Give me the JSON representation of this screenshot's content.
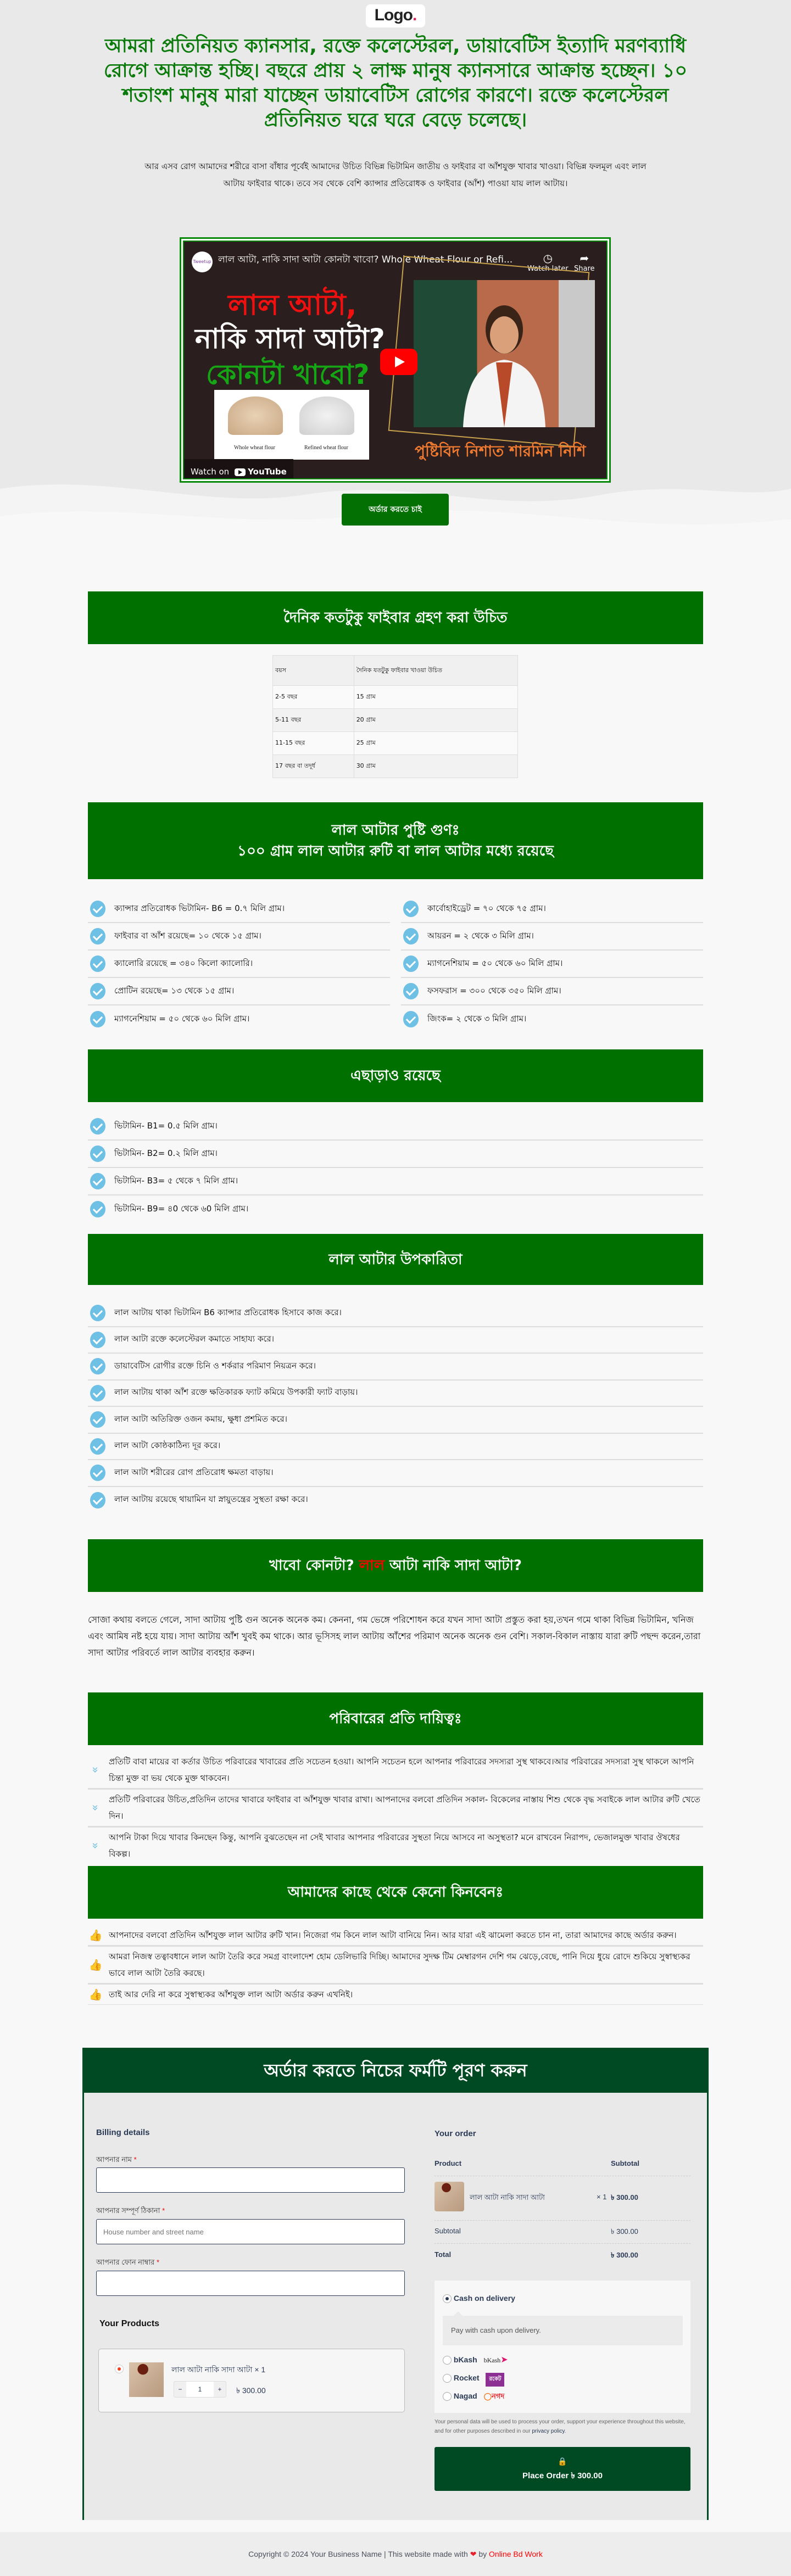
{
  "logo": {
    "text": "Logo",
    "dot": "."
  },
  "hero": {
    "headline": "আমরা প্রতিনিয়ত ক্যানসার, রক্তে কলেস্টেরল, ডায়াবেটিস ইত্যাদি মরণব্যাধি রোগে আক্রান্ত হচ্ছি। বছরে প্রায় ২ লাক্ষ মানুষ ক্যানসারে আক্রান্ত হচ্ছেন। ১০ শতাংশ মানুষ মারা যাচ্ছেন ডায়াবেটিস রোগের কারণে। রক্তে কলেস্টেরল প্রতিনিয়ত ঘরে ঘরে বেড়ে চলেছে।",
    "subtext": "আর এসব রোগ আমাদের শরীরে বাসা বাঁধার পূর্বেই আমাদের উচিত বিভিন্ন ভিটামিন জাতীয় ও ফাইবার বা আঁশযুক্ত খাবার খাওয়া। বিভিন্ন ফলমূল এবং লাল আটায় ফাইবার থাকে। তবে সব থেকে বেশি ক্যান্সার প্রতিরোধক ও ফাইবার (আঁশ) পাওয়া যায় লাল আটায়।"
  },
  "video": {
    "channel": "Tweetup",
    "title": "লাল আটা, নাকি সাদা আটা কোনটা খাবো? Whole Wheat Flour or Refi...",
    "watch_later": "Watch later",
    "share": "Share",
    "thumb_line1": "লাল আটা,",
    "thumb_line2": "নাকি সাদা আটা?",
    "thumb_line3": "কোনটা খাবো?",
    "flour_left": "Whole wheat flour",
    "flour_right": "Refined wheat flour",
    "speaker": "পুষ্টিবিদ নিশাত শারমিন নিশি",
    "watch_on": "Watch on",
    "youtube": "YouTube"
  },
  "cta": {
    "order_label": "অর্ডার করতে চাই"
  },
  "fiber": {
    "title": "দৈনিক কতটুকু ফাইবার গ্রহণ করা উচিত",
    "headers": [
      "বয়স",
      "দৈনিক যতটুকু ফাইবার খাওয়া উচিত"
    ],
    "rows": [
      [
        "2-5 বছর",
        "15 গ্রাম"
      ],
      [
        "5-11 বছর",
        "20 গ্রাম"
      ],
      [
        "11-15 বছর",
        "25 গ্রাম"
      ],
      [
        "17 বছর বা তদূর্ধ",
        "30 গ্রাম"
      ]
    ]
  },
  "nutrition": {
    "title_line1": "লাল আটার পুষ্টি গুণঃ",
    "title_line2": "১০০ গ্রাম লাল আটার রুটি বা লাল আটার মধ্যে রয়েছে",
    "left": [
      "ক্যান্সার প্রতিরোধক ভিটামিন- B6 = 0.৭ মিলি গ্রাম।",
      "ফাইবার বা আঁশ রয়েছে= ১০ থেকে ১৫ গ্রাম।",
      "ক্যালোরি রয়েছে = ৩৪০ কিলো ক্যালোরি।",
      "প্রোটিন রয়েছে= ১৩ থেকে ১৫ গ্রাম।",
      "ম্যাগনেশিয়াম = ৫০ থেকে ৬০ মিলি গ্রাম।"
    ],
    "right": [
      "কার্বোহাইড্রেট = ৭০ থেকে ৭৫ গ্রাম।",
      "আয়রন = ২ থেকে ৩ মিলি গ্রাম।",
      "ম্যাগনেশিয়াম = ৫০ থেকে ৬০ মিলি গ্রাম।",
      "ফসফরাস = ৩০০ থেকে ৩৫০ মিলি গ্রাম।",
      "জিংক= ২ থেকে ৩ মিলি গ্রাম।"
    ]
  },
  "extra": {
    "title": "এছাড়াও রয়েছে",
    "items": [
      "ভিটামিন- B1= 0.৫ মিলি গ্রাম।",
      "ভিটামিন- B2= 0.২ মিলি গ্রাম।",
      "ভিটামিন- B3= ৫ থেকে ৭ মিলি গ্রাম।",
      "ভিটামিন- B9= ৪0 থেকে ৬0 মিলি গ্রাম।"
    ]
  },
  "benefits": {
    "title": "লাল আটার উপকারিতা",
    "items": [
      "লাল আটায় থাকা ভিটামিন B6 ক্যান্সার প্রতিরোধক হিসাবে কাজ করে।",
      "লাল আটা রক্তে কলেস্টেরল কমাতে সাহায্য করে।",
      "ডায়াবেটিস রোগীর রক্তে চিনি ও শর্করার পরিমাণ নিয়ত্রন করে।",
      "লাল আটায় থাকা আঁশ রক্তে ক্ষতিকারক ফ্যাট কমিয়ে উপকারী ফ্যাট বাড়ায়।",
      "লাল আটা অতিরিক্ত ওজন কমায়, ক্ষুধা প্রশমিত করে।",
      "লাল আটা কোষ্ঠকাঠিন্য দূর করে।",
      "লাল আটা শরীরের রোগ প্রতিরোধ ক্ষমতা বাড়ায়।",
      "লাল আটায় রয়েছে থায়ামিন যা স্নায়ুতন্ত্রের সুস্থতা রক্ষা করে।"
    ]
  },
  "which": {
    "title_before": "খাবো কোনটা?",
    "title_red": "লাল",
    "title_after": "আটা নাকি সাদা আটা?",
    "paragraph": "সোজা কথায় বলতে গেলে, সাদা আটায় পুষ্টি গুন অনেক অনেক কম। কেননা, গম ভেঙ্গে পরিশোধন করে যখন সাদা আটা প্রস্তুত করা হয়,তখন গমে থাকা বিভিন্ন ভিটামিন, খনিজ এবং আমিষ নষ্ট হয়ে যায়। সাদা আটায় আঁশ খুবই কম থাকে। আর ভূসিসহ লাল আটায় আঁশের পরিমাণ অনেক অনেক গুন বেশি। সকাল-বিকাল নাস্তায় যারা রুটি পছন্দ করেন,তারা সাদা আটার পরিবর্তে লাল আটার ব্যবহার করুন।"
  },
  "family": {
    "title": "পরিবারের প্রতি দায়িত্বঃ",
    "items": [
      "প্রতিটি বাবা মায়ের বা কর্তার উচিত পরিবারের খাবারের প্রতি সচেতন হওয়া। আপনি সচেতন হলে আপনার পরিবারের সদস্যরা সুস্থ থাকবে।আর পরিবারের সদস্যরা সুস্থ থাকলে আপনি চিন্তা মুক্ত বা ভয় থেকে মুক্ত থাকবেন।",
      "প্রতিটি পরিবারের উচিত,প্রতিদিন তাদের খাবারে ফাইবার বা আঁশযুক্ত খাবার রাখা। আপনাদের বলবো প্রতিদিন সকাল- বিকেলের নাস্তায় শিশু থেকে বৃদ্ধ সবাইকে লাল আটার রুটি খেতে দিন।",
      "আপনি টাকা দিয়ে খাবার কিনছেন কিন্তু, আপনি বুঝতেছেন না সেই খাবার আপনার পরিবারের সুস্থতা নিয়ে আসবে না অসুস্থতা? মনে রাখবেন নিরাপদ, ভেজালমুক্ত খাবার ঔষধের বিকল্প।"
    ]
  },
  "why": {
    "title": "আমাদের কাছে থেকে কেনো কিনবেনঃ",
    "items": [
      "আপনাদের বলবো প্রতিদিন আঁশযুক্ত লাল আটার রুটি খান। নিজেরা গম কিনে লাল আটা বানিয়ে নিন। আর যারা এই ঝামেলা করতে চান না, তারা আমাদের কাছে অর্ডার করুন।",
      "আমরা নিজস্ব তত্বাবধানে লাল আটা তৈরি করে সমগ্র বাংলাদেশ হোম ডেলিভারি দিচ্ছি। আমাদের সুদক্ষ টিম মেম্বারগন দেশি গম ঝেড়ে,বেছে, পানি দিয়ে ধুয়ে রোদে শুকিয়ে সুস্বাস্থ্যকর ভাবে লাল আটা তৈরি করছে।",
      "তাই আর দেরি না করে সুস্বাস্থ্যকর আঁশযুক্ত লাল আটা অর্ডার করুন এখনিই।"
    ]
  },
  "checkout": {
    "title": "অর্ডার করতে নিচের ফর্মটি পূরণ করুন",
    "billing_title": "Billing details",
    "name_label": "আপনার নাম",
    "address_label": "আপনার সম্পূর্ণ ঠিকানা",
    "address_placeholder": "House number and street name",
    "phone_label": "আপনার ফোন নাম্বার",
    "required": "*",
    "products_title": "Your Products",
    "product_name": "লাল আটা নাকি সাদা আটা  × 1",
    "qty": "1",
    "qty_minus": "−",
    "qty_plus": "+",
    "product_price": "৳ 300.00",
    "order_title": "Your order",
    "col_product": "Product",
    "col_subtotal": "Subtotal",
    "line_name": "লাল আটা নাকি সাদা আটা",
    "line_qty": "× 1",
    "line_price": "৳ 300.00",
    "subtotal_label": "Subtotal",
    "subtotal_value": "৳ 300.00",
    "total_label": "Total",
    "total_value": "৳ 300.00",
    "payment": {
      "cod": "Cash on delivery",
      "cod_desc": "Pay with cash upon delivery.",
      "bkash": "bKash",
      "bkash_logo": "bKash",
      "rocket": "Rocket",
      "rocket_logo": "রকেট",
      "nagad": "Nagad",
      "nagad_logo": "নগদ",
      "selected": "Cash on delivery"
    },
    "privacy_text": "Your personal data will be used to process your order, support your experience throughout this website, and for other purposes described in our ",
    "privacy_link": "privacy policy",
    "privacy_end": ".",
    "place_order": "Place Order  ৳ 300.00"
  },
  "footer": {
    "text": "Copyright © 2024 Your Business Name | This website made with",
    "by": "by",
    "link": "Online Bd Work"
  },
  "colors": {
    "section_green": "#007000",
    "form_green": "#004a23",
    "check_blue": "#6ec1e4",
    "accent_red": "#ff0000"
  }
}
